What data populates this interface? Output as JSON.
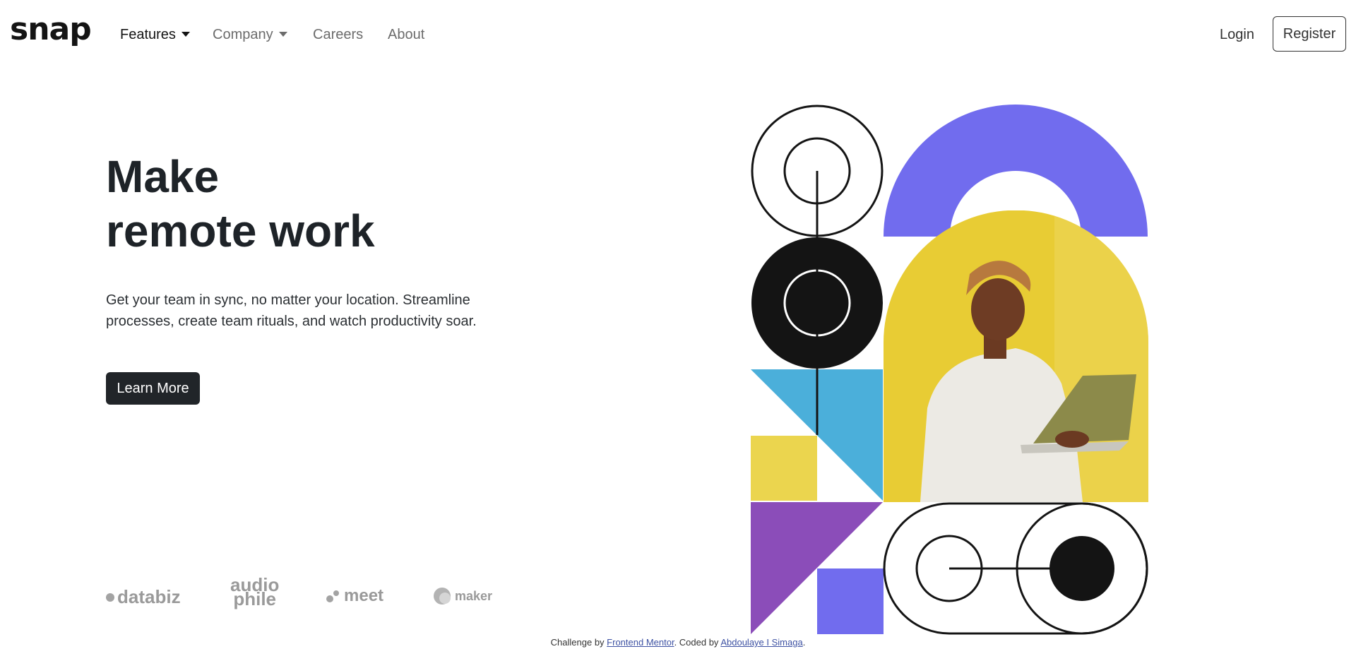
{
  "brand": {
    "name": "snap"
  },
  "nav": {
    "features": "Features",
    "company": "Company",
    "careers": "Careers",
    "about": "About",
    "login": "Login",
    "register": "Register"
  },
  "hero": {
    "title_line1": "Make",
    "title_line2": "remote work",
    "description": "Get your team in sync, no matter your location. Streamline processes, create team rituals, and watch productivity soar.",
    "cta": "Learn More"
  },
  "clients": {
    "databiz": "databiz",
    "audiophile_top": "audio",
    "audiophile_bottom": "phile",
    "meet": "meet",
    "maker": "maker"
  },
  "footer": {
    "challenge_prefix": "Challenge by ",
    "challenge_link": "Frontend Mentor",
    "coded_prefix": ". Coded by ",
    "author_link": "Abdoulaye I Simaga",
    "suffix": "."
  },
  "colors": {
    "purple": "#716CEE",
    "yellow": "#EBD54E",
    "sky": "#4BAFDA",
    "violet": "#8B4DB9",
    "black": "#141414"
  }
}
